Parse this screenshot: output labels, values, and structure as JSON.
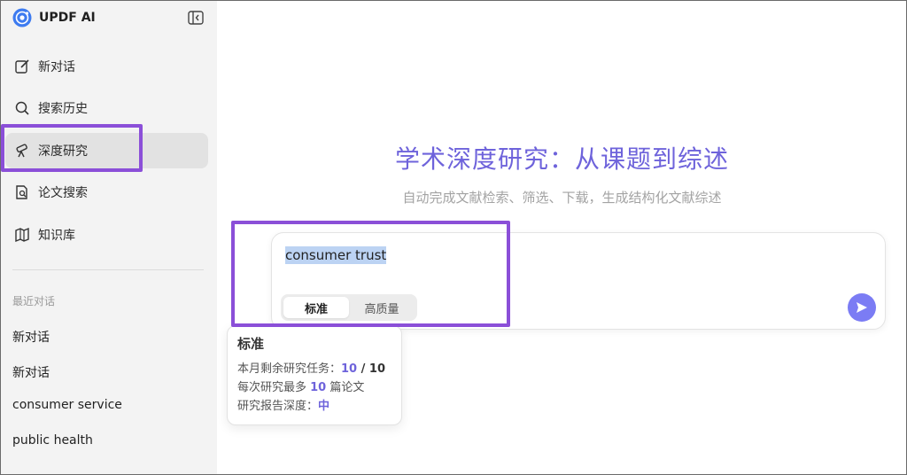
{
  "app": {
    "name": "UPDF AI"
  },
  "sidebar": {
    "nav": [
      {
        "label": "新对话",
        "icon": "edit-icon"
      },
      {
        "label": "搜索历史",
        "icon": "search-icon"
      },
      {
        "label": "深度研究",
        "icon": "telescope-icon"
      },
      {
        "label": "论文搜索",
        "icon": "paper-search-icon"
      },
      {
        "label": "知识库",
        "icon": "book-icon"
      }
    ],
    "recent_title": "最近对话",
    "recent": [
      "新对话",
      "新对话",
      "consumer service",
      "public health"
    ]
  },
  "main": {
    "headline": "学术深度研究：从课题到综述",
    "subline": "自动完成文献检索、筛选、下载，生成结构化文献综述",
    "composer": {
      "query": "consumer trust",
      "modes": [
        "标准",
        "高质量"
      ],
      "active_mode": "标准"
    },
    "tooltip": {
      "title": "标准",
      "line1_prefix": "本月剩余研究任务：",
      "line1_used": "10",
      "line1_sep": " / ",
      "line1_total": "10",
      "line2_prefix": "每次研究最多 ",
      "line2_value": "10",
      "line2_suffix": " 篇论文",
      "line3_prefix": "研究报告深度：",
      "line3_value": "中"
    }
  },
  "colors": {
    "accent": "#6e63db",
    "send": "#7b7cf4",
    "highlight_box": "#8b4fd8",
    "selection": "#bcd3f3"
  }
}
